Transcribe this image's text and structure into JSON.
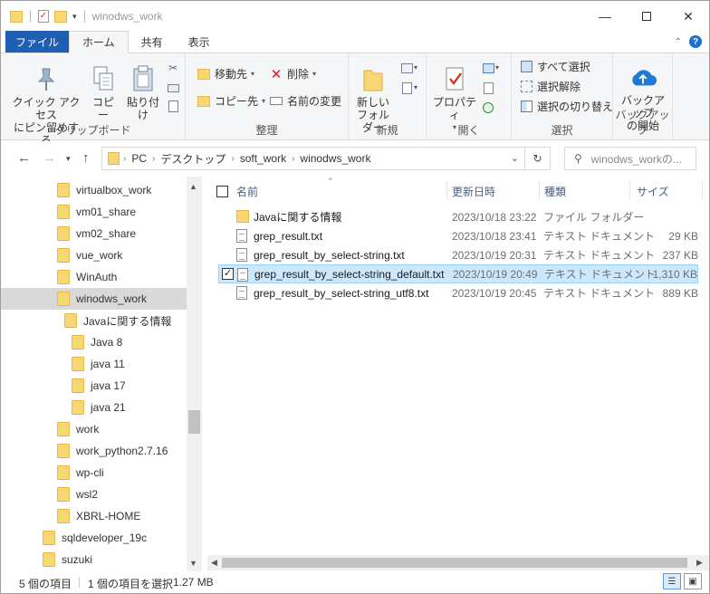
{
  "window": {
    "title": "winodws_work"
  },
  "ribbon_tabs": [
    "ファイル",
    "ホーム",
    "共有",
    "表示"
  ],
  "ribbon": {
    "clipboard": {
      "pin_label": "クイック アクセス\nにピン留めする",
      "pin_line1": "クイック アクセス",
      "pin_line2": "にピン留めする",
      "copy": "コピー",
      "paste": "貼り付け",
      "label": "クリップボード"
    },
    "organize": {
      "move_to": "移動先",
      "copy_to": "コピー先",
      "delete": "削除",
      "rename": "名前の変更",
      "label": "整理"
    },
    "new": {
      "new_folder_line1": "新しい",
      "new_folder_line2": "フォルダー",
      "label": "新規"
    },
    "open": {
      "properties": "プロパティ",
      "label": "開く"
    },
    "select": {
      "select_all": "すべて選択",
      "select_none": "選択解除",
      "invert": "選択の切り替え",
      "label": "選択"
    },
    "backup": {
      "line1": "バックアップ",
      "line2": "の開始",
      "label": "バックアップ"
    }
  },
  "address": {
    "crumbs": [
      "PC",
      "デスクトップ",
      "soft_work",
      "winodws_work"
    ],
    "search_placeholder": "winodws_workの..."
  },
  "nav": [
    {
      "label": "virtualbox_work",
      "indent": 1
    },
    {
      "label": "vm01_share",
      "indent": 1
    },
    {
      "label": "vm02_share",
      "indent": 1
    },
    {
      "label": "vue_work",
      "indent": 1
    },
    {
      "label": "WinAuth",
      "indent": 1
    },
    {
      "label": "winodws_work",
      "indent": 1,
      "selected": true
    },
    {
      "label": "Javaに関する情報",
      "indent": 2
    },
    {
      "label": "Java 8",
      "indent": 3
    },
    {
      "label": "java 11",
      "indent": 3
    },
    {
      "label": "java 17",
      "indent": 3
    },
    {
      "label": "java 21",
      "indent": 3
    },
    {
      "label": "work",
      "indent": 1
    },
    {
      "label": "work_python2.7.16",
      "indent": 1
    },
    {
      "label": "wp-cli",
      "indent": 1
    },
    {
      "label": "wsl2",
      "indent": 1
    },
    {
      "label": "XBRL-HOME",
      "indent": 1
    },
    {
      "label": "sqldeveloper_19c",
      "indent": 0
    },
    {
      "label": "suzuki",
      "indent": 0
    }
  ],
  "columns": {
    "name": "名前",
    "date": "更新日時",
    "type": "種類",
    "size": "サイズ"
  },
  "files": [
    {
      "name": "Javaに関する情報",
      "date": "2023/10/18 23:22",
      "type": "ファイル フォルダー",
      "size": "",
      "kind": "folder"
    },
    {
      "name": "grep_result.txt",
      "date": "2023/10/18 23:41",
      "type": "テキスト ドキュメント",
      "size": "29 KB",
      "kind": "file"
    },
    {
      "name": "grep_result_by_select-string.txt",
      "date": "2023/10/19 20:31",
      "type": "テキスト ドキュメント",
      "size": "237 KB",
      "kind": "file"
    },
    {
      "name": "grep_result_by_select-string_default.txt",
      "date": "2023/10/19 20:49",
      "type": "テキスト ドキュメント",
      "size": "1,310 KB",
      "kind": "file",
      "selected": true
    },
    {
      "name": "grep_result_by_select-string_utf8.txt",
      "date": "2023/10/19 20:45",
      "type": "テキスト ドキュメント",
      "size": "889 KB",
      "kind": "file"
    }
  ],
  "status": {
    "count": "5 個の項目",
    "selection": "1 個の項目を選択",
    "size": "1.27 MB"
  },
  "colors": {
    "file_tab": "#1e5fb4",
    "selection": "#cce8ff",
    "folder": "#f8d775"
  }
}
